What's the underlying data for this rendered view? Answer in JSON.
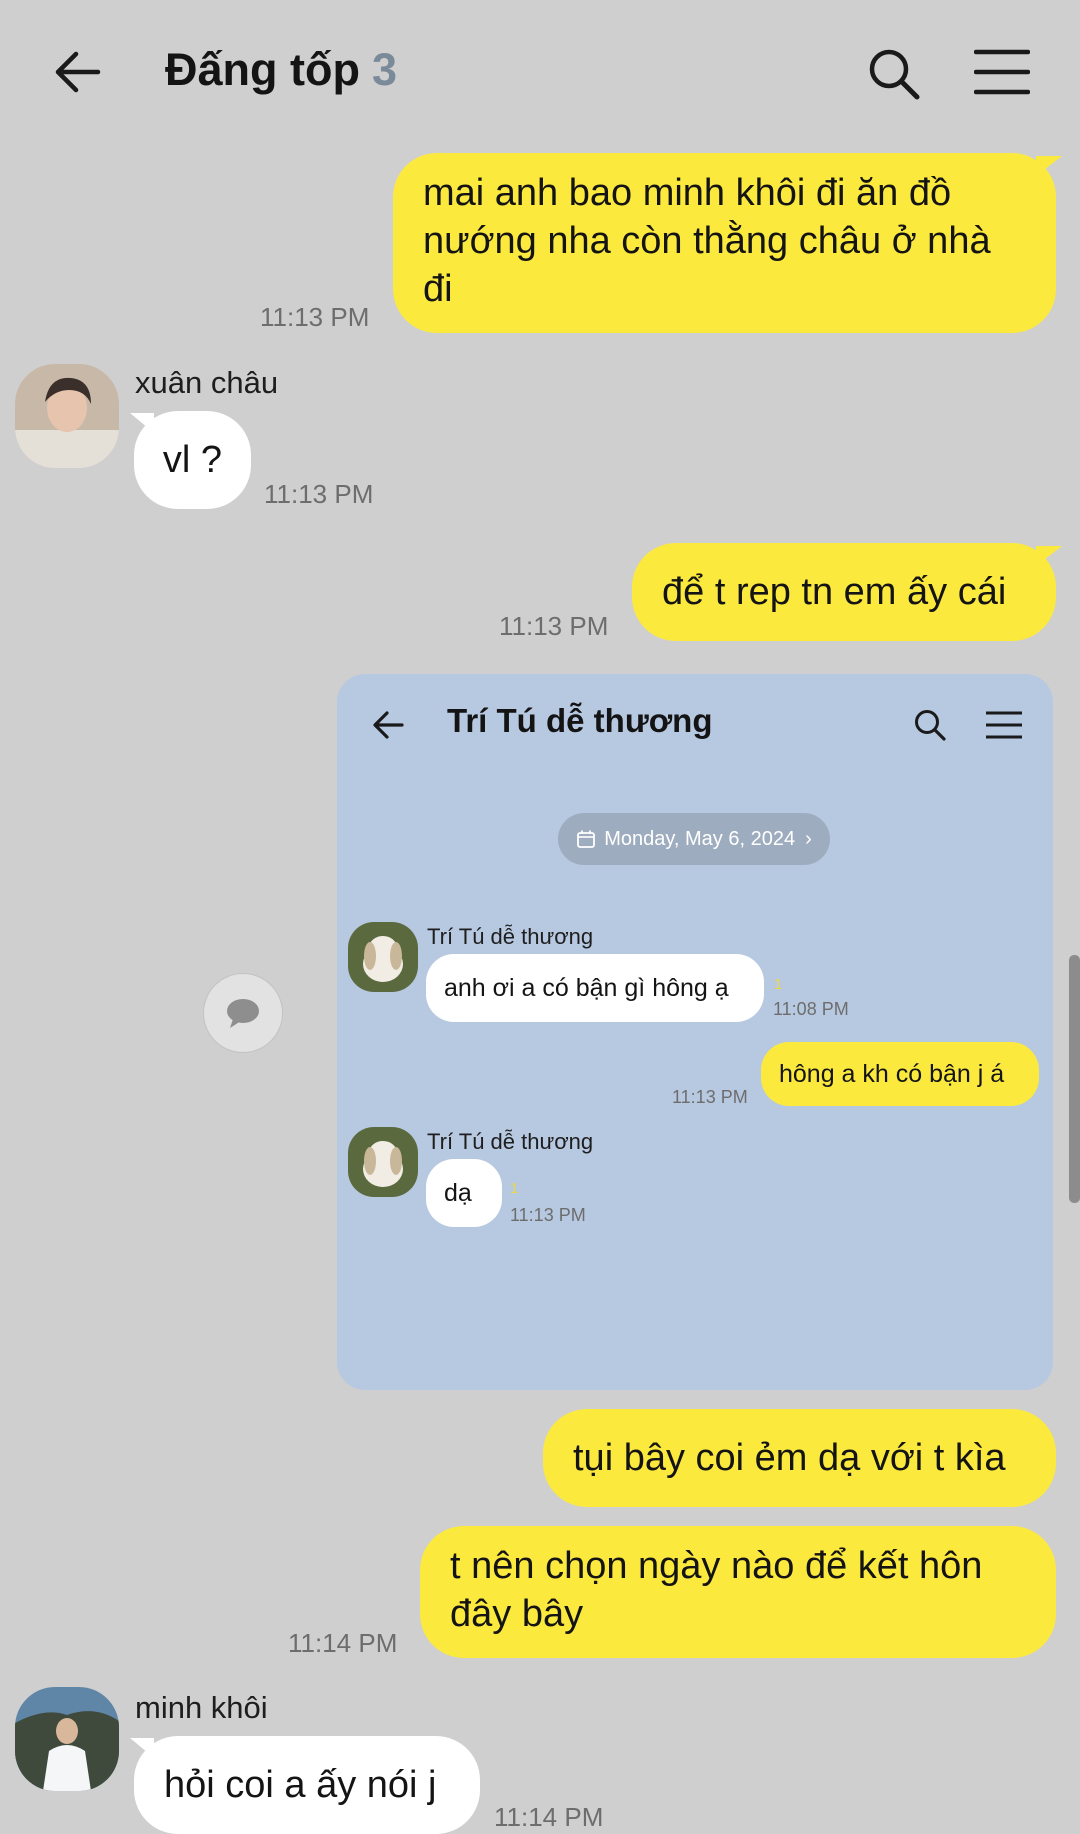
{
  "header": {
    "title": "Đấng tốp",
    "member_count": "3",
    "back_icon": "arrow-left-icon",
    "search_icon": "search-icon",
    "menu_icon": "hamburger-menu-icon"
  },
  "messages": [
    {
      "type": "out",
      "text": "mai anh bao minh khôi đi ăn đồ nướng nha còn thằng châu ở nhà đi",
      "time": "11:13 PM"
    },
    {
      "type": "in",
      "sender": "xuân châu",
      "text": "vl ?",
      "time": "11:13 PM"
    },
    {
      "type": "out",
      "text": "để t rep tn em ấy cái",
      "time": "11:13 PM"
    },
    {
      "type": "out",
      "text": "tụi bây coi ẻm dạ với t kìa",
      "time": ""
    },
    {
      "type": "out",
      "text": "t nên chọn ngày nào để kết hôn đây bây",
      "time": "11:14 PM"
    },
    {
      "type": "in",
      "sender": "minh khôi",
      "text": "hỏi coi a ấy nói j",
      "time": "11:14 PM"
    }
  ],
  "shared_screenshot": {
    "title": "Trí Tú dễ thương",
    "date_label": "Monday, May 6, 2024",
    "read_count": "1",
    "messages": [
      {
        "type": "in",
        "sender": "Trí Tú dễ thương",
        "text": "anh ơi a có bận gì hông ạ",
        "time": "11:08 PM"
      },
      {
        "type": "out",
        "text": "hông a kh có bận j á",
        "time": "11:13 PM"
      },
      {
        "type": "in",
        "sender": "Trí Tú dễ thương",
        "text": "dạ",
        "time": "11:13 PM"
      }
    ]
  },
  "colors": {
    "background": "#cfcfcf",
    "outgoing_bubble": "#fce93e",
    "incoming_bubble": "#ffffff",
    "screenshot_background": "#b7c8e1",
    "member_count": "#7b8a99"
  }
}
